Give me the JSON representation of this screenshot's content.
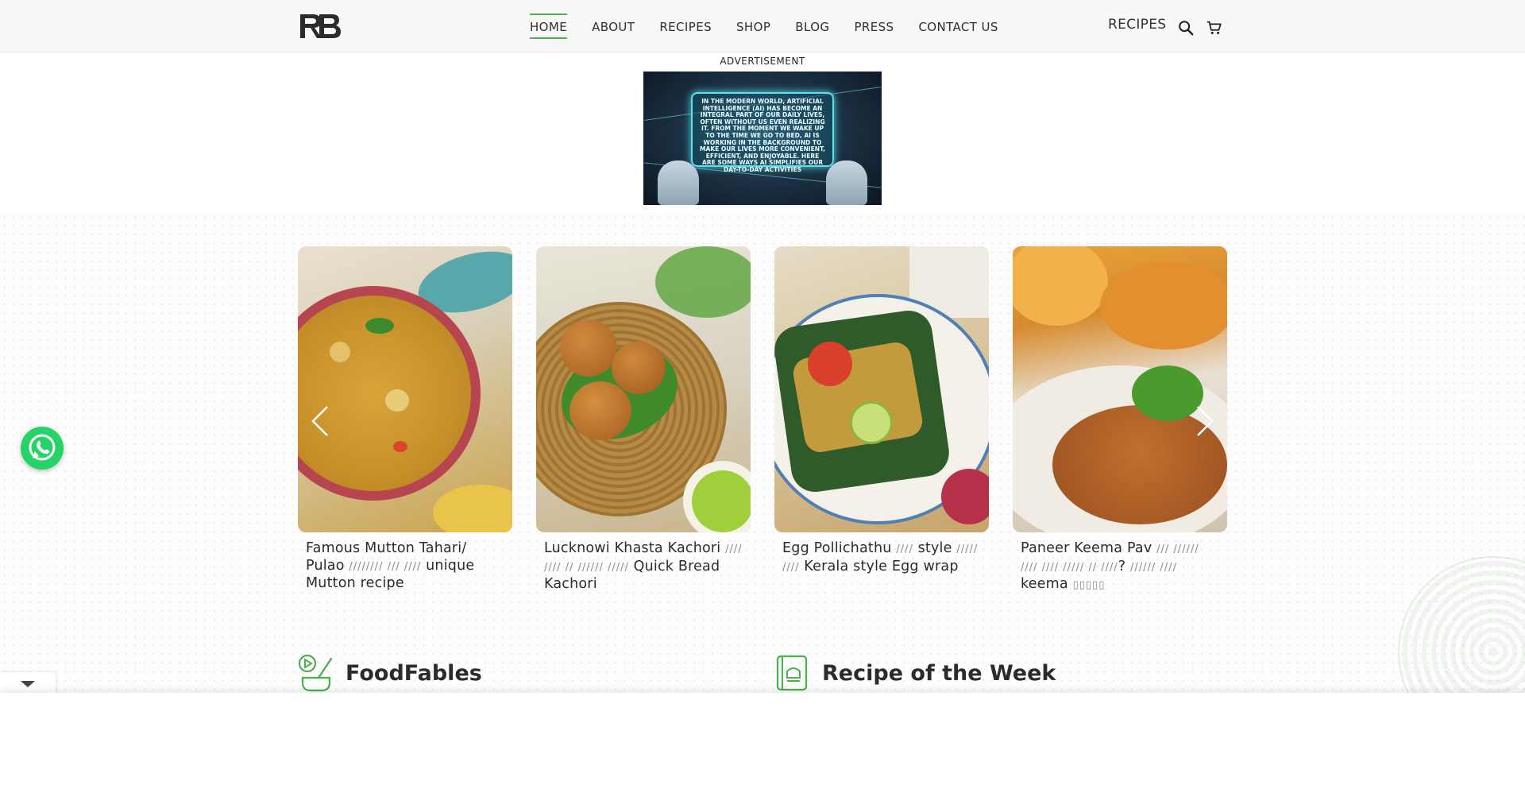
{
  "header": {
    "logo_alt": "RB logo",
    "nav": [
      {
        "label": "HOME",
        "active": true
      },
      {
        "label": "ABOUT"
      },
      {
        "label": "RECIPES"
      },
      {
        "label": "SHOP"
      },
      {
        "label": "BLOG"
      },
      {
        "label": "PRESS"
      },
      {
        "label": "CONTACT US"
      }
    ],
    "recipes_label": "RECIPES",
    "icons": [
      "search-icon",
      "cart-icon"
    ],
    "accent": "#4caf50"
  },
  "advertisement": {
    "label": "ADVERTISEMENT",
    "text": "IN THE MODERN WORLD, ARTIFICIAL INTELLIGENCE (AI) HAS BECOME AN INTEGRAL PART OF OUR DAILY LIVES, OFTEN WITHOUT US EVEN REALIZING IT. FROM THE MOMENT WE WAKE UP TO THE TIME WE GO TO BED, AI IS WORKING IN THE BACKGROUND TO MAKE OUR LIVES MORE CONVENIENT, EFFICIENT, AND ENJOYABLE. HERE ARE SOME WAYS AI SIMPLIFIES OUR DAY-TO-DAY ACTIVITIES"
  },
  "carousel": {
    "cards": [
      {
        "title_a": "Famous Mutton Tahari/ Pulao ",
        "title_b": "//////// /// ////",
        "title_c": " unique Mutton recipe"
      },
      {
        "title_a": "Lucknowi Khasta Kachori ",
        "title_b": "//// //// // ////// /////",
        "title_c": " Quick Bread Kachori"
      },
      {
        "title_a": "Egg Pollichathu ",
        "title_b": "////",
        "title_c": " style ",
        "title_d": "///// ////",
        "title_e": " Kerala style Egg wrap"
      },
      {
        "title_a": "Paneer Keema Pav ",
        "title_b": "/// ////// //// //// ///// // ////",
        "title_c": "? ",
        "title_d": "////// ////",
        "title_e": " keema ",
        "title_f": "▯▯▯▯▯"
      }
    ]
  },
  "sections": [
    {
      "title": "FoodFables",
      "icon": "video-bowl-icon"
    },
    {
      "title": "Recipe of the Week",
      "icon": "recipe-book-icon"
    }
  ]
}
